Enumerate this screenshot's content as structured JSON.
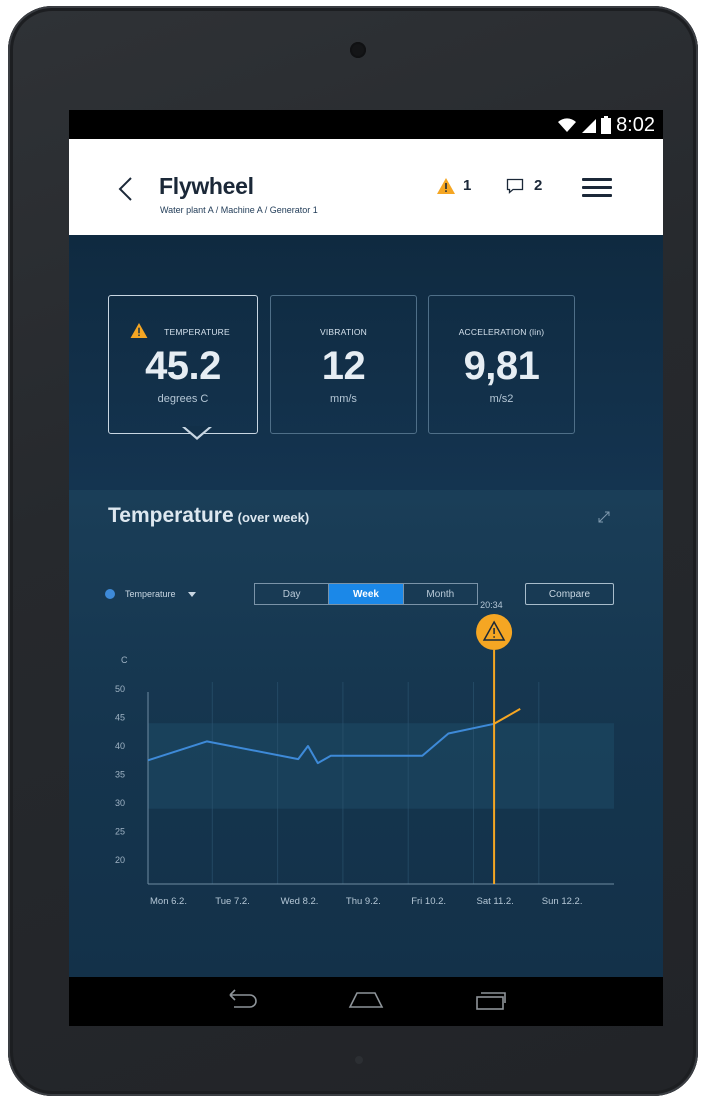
{
  "status_bar": {
    "time": "8:02"
  },
  "header": {
    "back_icon": "chevron-left-icon",
    "title": "Flywheel",
    "breadcrumb": "Water plant A / Machine A / Generator 1",
    "alert_count": "1",
    "message_count": "2",
    "menu_icon": "hamburger-menu-icon"
  },
  "kpis": [
    {
      "label": "TEMPERATURE",
      "value": "45.2",
      "unit": "degrees C",
      "warning": true
    },
    {
      "label": "VIBRATION",
      "value": "12",
      "unit": "mm/s",
      "warning": false
    },
    {
      "label": "ACCELERATION (lin)",
      "value": "9,81",
      "unit": "m/s2",
      "warning": false
    }
  ],
  "chart_panel": {
    "title": "Temperature",
    "subtitle": "(over week)",
    "series_selector": "Temperature",
    "ranges": [
      "Day",
      "Week",
      "Month"
    ],
    "active_range": "Week",
    "compare_label": "Compare",
    "marker_time": "20:34"
  },
  "colors": {
    "series": "#3e8ad8",
    "alert": "#f5a623",
    "active_tab": "#1b88e8",
    "background": "#133149"
  },
  "chart_data": {
    "type": "line",
    "title": "Temperature",
    "subtitle": "(over week)",
    "ylabel": "C",
    "categories": [
      "Mon 6.2.",
      "Tue 7.2.",
      "Wed 8.2.",
      "Thu 9.2.",
      "Fri 10.2.",
      "Sat 11.2.",
      "Sun 12.2."
    ],
    "y_ticks": [
      50,
      45,
      40,
      35,
      30,
      25,
      20
    ],
    "ylim": [
      15,
      50
    ],
    "grid": true,
    "threshold_band": [
      29,
      44
    ],
    "series": [
      {
        "name": "Temperature",
        "color": "#3e8ad8",
        "points": [
          [
            0,
            37.5
          ],
          [
            0.9,
            40.8
          ],
          [
            2.3,
            37.7
          ],
          [
            2.45,
            40.0
          ],
          [
            2.6,
            37.0
          ],
          [
            2.8,
            38.3
          ],
          [
            4.2,
            38.3
          ],
          [
            4.6,
            42.2
          ],
          [
            5.3,
            43.9
          ]
        ]
      },
      {
        "name": "Alert",
        "color": "#f5a623",
        "points": [
          [
            5.3,
            43.9
          ],
          [
            5.7,
            46.5
          ]
        ]
      }
    ],
    "alert_marker": {
      "x": 5.3,
      "label": "20:34"
    }
  }
}
